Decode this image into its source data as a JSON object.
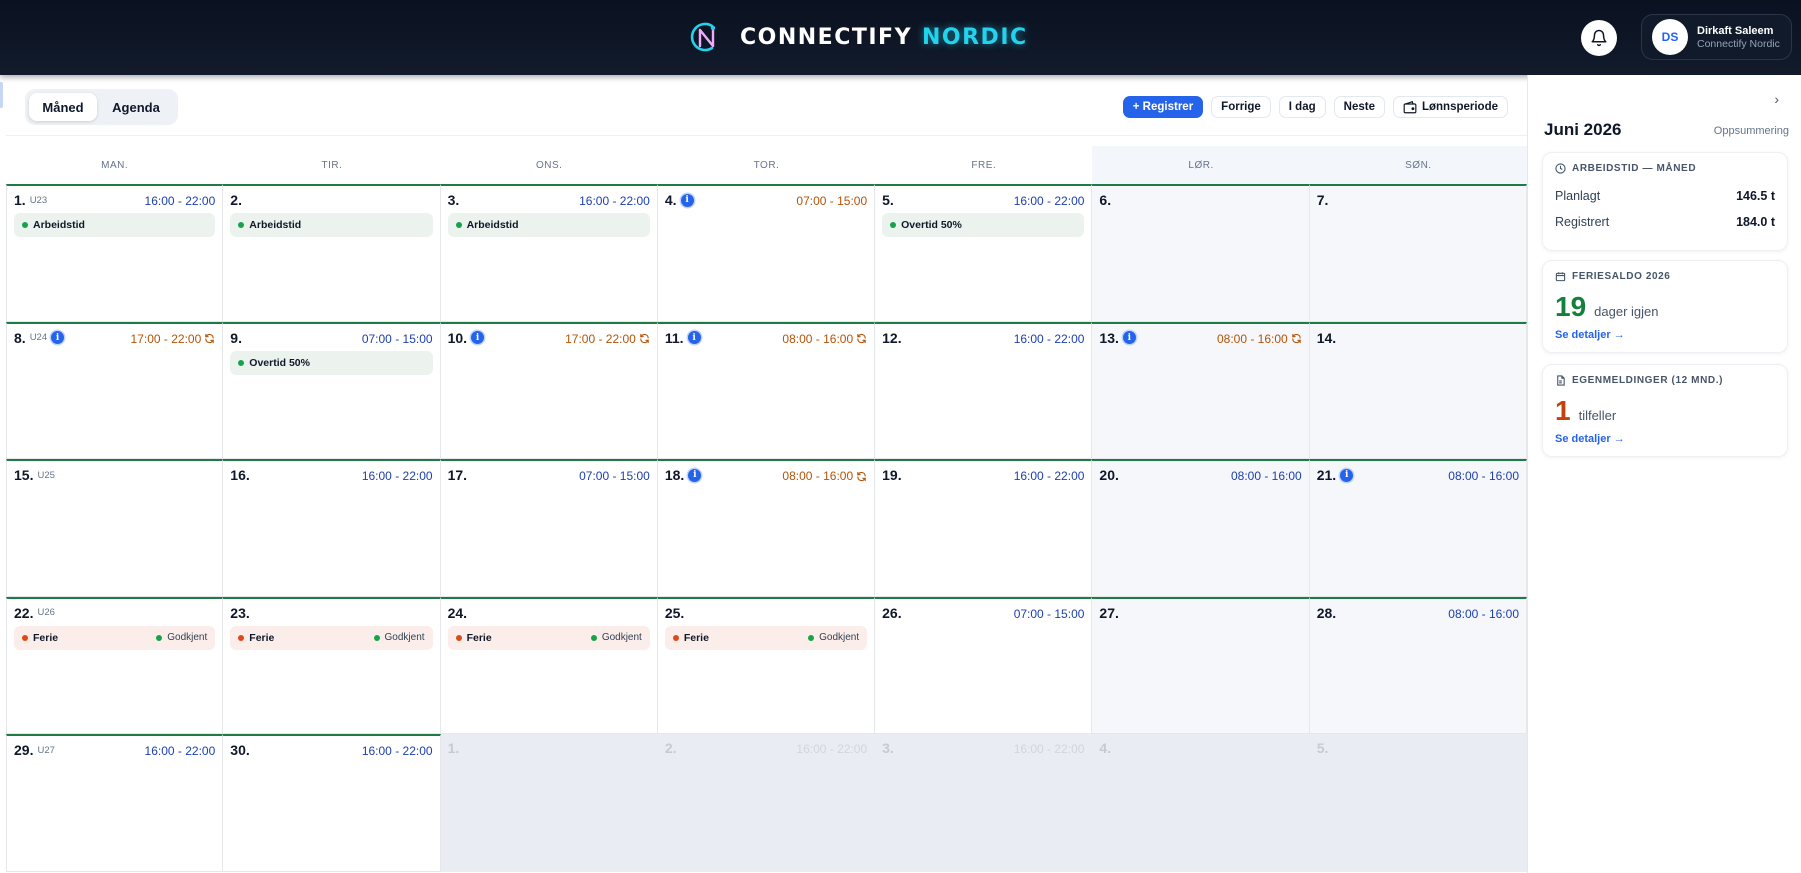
{
  "header": {
    "brand_main": "CONNECTIFY",
    "brand_accent": "NORDIC",
    "user_initials": "DS",
    "user_name": "Dirkaft Saleem",
    "user_org": "Connectify Nordic",
    "colors": {
      "bg": "#0a1120",
      "accent": "#22d3ee"
    }
  },
  "toolbar": {
    "view_month": "Måned",
    "view_agenda": "Agenda",
    "register_label": "+ Registrer",
    "prev_label": "Forrige",
    "today_label": "I dag",
    "next_label": "Neste",
    "payperiod_label": "Lønnsperiode",
    "colors": {
      "primary": "#2563eb"
    }
  },
  "calendar": {
    "weekdays": [
      "MAN.",
      "TIR.",
      "ONS.",
      "TOR.",
      "FRE.",
      "LØR.",
      "SØN."
    ],
    "colors": {
      "week_line": "#1f7a45",
      "planned_time": "#1e40af",
      "pending_time": "#b45309"
    },
    "days": [
      {
        "day": "1.",
        "week": "U23",
        "time": "16:00 - 22:00",
        "event": "Arbeidstid"
      },
      {
        "day": "2.",
        "event": "Arbeidstid"
      },
      {
        "day": "3.",
        "time": "16:00 - 22:00",
        "event": "Arbeidstid"
      },
      {
        "day": "4.",
        "info": true,
        "time": "07:00 - 15:00",
        "pending": true
      },
      {
        "day": "5.",
        "time": "16:00 - 22:00",
        "event": "Overtid 50%"
      },
      {
        "day": "6.",
        "weekend": true
      },
      {
        "day": "7.",
        "weekend": true
      },
      {
        "day": "8.",
        "week": "U24",
        "info": true,
        "time": "17:00 - 22:00",
        "pending": true,
        "sync": true
      },
      {
        "day": "9.",
        "time": "07:00 - 15:00",
        "event": "Overtid 50%"
      },
      {
        "day": "10.",
        "info": true,
        "time": "17:00 - 22:00",
        "pending": true,
        "sync": true
      },
      {
        "day": "11.",
        "info": true,
        "time": "08:00 - 16:00",
        "pending": true,
        "sync": true
      },
      {
        "day": "12.",
        "time": "16:00 - 22:00"
      },
      {
        "day": "13.",
        "info": true,
        "time": "08:00 - 16:00",
        "pending": true,
        "sync": true,
        "weekend": true
      },
      {
        "day": "14.",
        "weekend": true
      },
      {
        "day": "15.",
        "week": "U25"
      },
      {
        "day": "16.",
        "time": "16:00 - 22:00"
      },
      {
        "day": "17.",
        "time": "07:00 - 15:00"
      },
      {
        "day": "18.",
        "info": true,
        "time": "08:00 - 16:00",
        "pending": true,
        "sync": true
      },
      {
        "day": "19.",
        "time": "16:00 - 22:00"
      },
      {
        "day": "20.",
        "time": "08:00 - 16:00",
        "weekend": true
      },
      {
        "day": "21.",
        "info": true,
        "time": "08:00 - 16:00",
        "weekend": true
      },
      {
        "day": "22.",
        "week": "U26",
        "event": "Ferie",
        "vacation": true,
        "status": "Godkjent"
      },
      {
        "day": "23.",
        "event": "Ferie",
        "vacation": true,
        "status": "Godkjent"
      },
      {
        "day": "24.",
        "event": "Ferie",
        "vacation": true,
        "status": "Godkjent"
      },
      {
        "day": "25.",
        "event": "Ferie",
        "vacation": true,
        "status": "Godkjent"
      },
      {
        "day": "26.",
        "time": "07:00 - 15:00"
      },
      {
        "day": "27.",
        "weekend": true
      },
      {
        "day": "28.",
        "time": "08:00 - 16:00",
        "weekend": true
      },
      {
        "day": "29.",
        "week": "U27",
        "time": "16:00 - 22:00"
      },
      {
        "day": "30.",
        "time": "16:00 - 22:00"
      },
      {
        "day": "1.",
        "outside": true
      },
      {
        "day": "2.",
        "time": "16:00 - 22:00",
        "outside": true
      },
      {
        "day": "3.",
        "time": "16:00 - 22:00",
        "outside": true
      },
      {
        "day": "4.",
        "outside": true
      },
      {
        "day": "5.",
        "outside": true
      }
    ]
  },
  "panel": {
    "title": "Juni 2026",
    "subtitle": "Oppsummering",
    "worktime": {
      "heading": "ARBEIDSTID — MÅNED",
      "planned_label": "Planlagt",
      "planned_value": "146.5 t",
      "registered_label": "Registrert",
      "registered_value": "184.0 t"
    },
    "vacation": {
      "heading": "FERIESALDO 2026",
      "value": "19",
      "unit": "dager igjen",
      "link": "Se detaljer →"
    },
    "sick": {
      "heading": "EGENMELDINGER (12 MND.)",
      "value": "1",
      "unit": "tilfeller",
      "link": "Se detaljer →"
    }
  }
}
